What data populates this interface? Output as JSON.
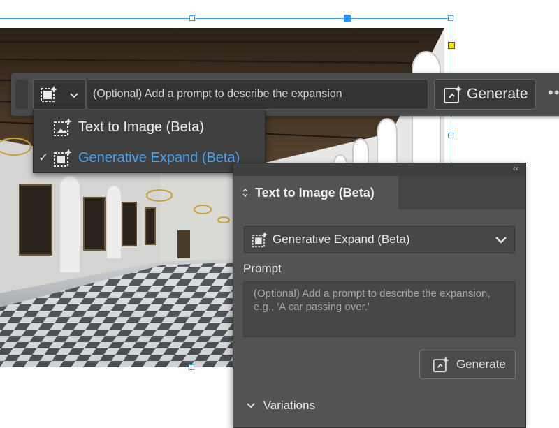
{
  "taskbar": {
    "prompt_placeholder": "(Optional) Add a prompt to describe the expansion",
    "generate_label": "Generate",
    "more_label": "••"
  },
  "menu": {
    "items": [
      {
        "label": "Text to Image (Beta)",
        "icon": "text-to-image-icon",
        "selected": false
      },
      {
        "label": "Generative Expand (Beta)",
        "icon": "generative-expand-icon",
        "selected": true
      }
    ],
    "check": "✓"
  },
  "panel": {
    "collapse": "‹‹",
    "tab_label": "Text to Image (Beta)",
    "select_value": "Generative Expand (Beta)",
    "prompt_label": "Prompt",
    "prompt_placeholder": "(Optional) Add a prompt to describe the expansion, e.g., 'A car passing over.'",
    "generate_label": "Generate",
    "variations_label": "Variations"
  },
  "colors": {
    "selection": "#3a9be0",
    "accent_blue": "#4aa3f0",
    "panel_bg": "#535353",
    "bar_bg": "#4a4a4a"
  }
}
